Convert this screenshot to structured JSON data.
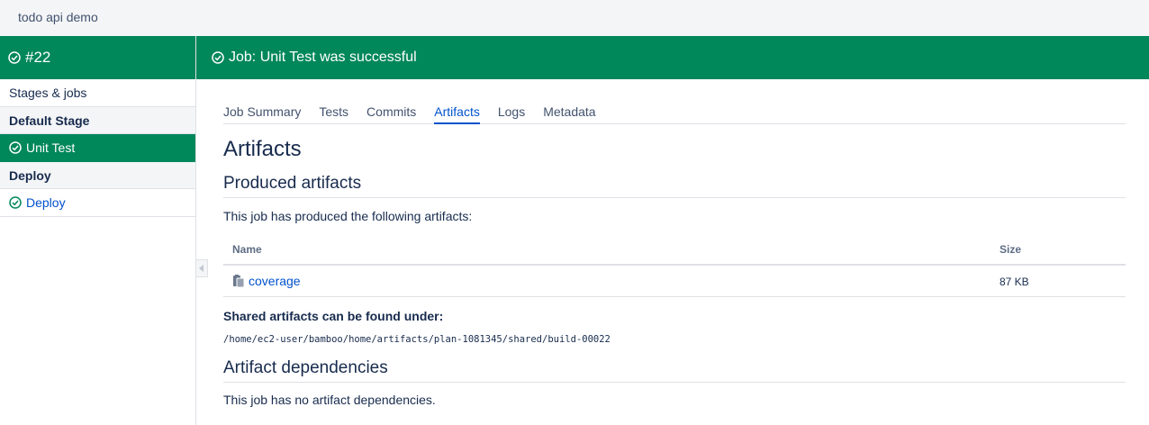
{
  "app": {
    "title": "todo api demo"
  },
  "sidebar": {
    "build_number": "#22",
    "stages_jobs_label": "Stages & jobs",
    "stages": [
      {
        "name": "Default Stage",
        "jobs": [
          {
            "label": "Unit Test",
            "active": true
          }
        ]
      },
      {
        "name": "Deploy",
        "jobs": [
          {
            "label": "Deploy",
            "active": false
          }
        ]
      }
    ]
  },
  "header": {
    "title": "Job: Unit Test was successful"
  },
  "tabs": [
    {
      "label": "Job Summary"
    },
    {
      "label": "Tests"
    },
    {
      "label": "Commits"
    },
    {
      "label": "Artifacts",
      "active": true
    },
    {
      "label": "Logs"
    },
    {
      "label": "Metadata"
    }
  ],
  "main": {
    "title": "Artifacts",
    "produced_heading": "Produced artifacts",
    "produced_text": "This job has produced the following artifacts:",
    "table": {
      "columns": [
        "Name",
        "Size"
      ],
      "rows": [
        {
          "name": "coverage",
          "size": "87 KB"
        }
      ]
    },
    "shared_label": "Shared artifacts can be found under:",
    "shared_path": "/home/ec2-user/bamboo/home/artifacts/plan-1081345/shared/build-00022",
    "dependencies_heading": "Artifact dependencies",
    "dependencies_text": "This job has no artifact dependencies."
  },
  "colors": {
    "success": "#00875a",
    "link": "#0052cc",
    "text": "#172b4d"
  },
  "icons": {
    "success": "check-circle-icon",
    "artifact": "artifact-icon",
    "collapse": "chevron-left-icon"
  }
}
